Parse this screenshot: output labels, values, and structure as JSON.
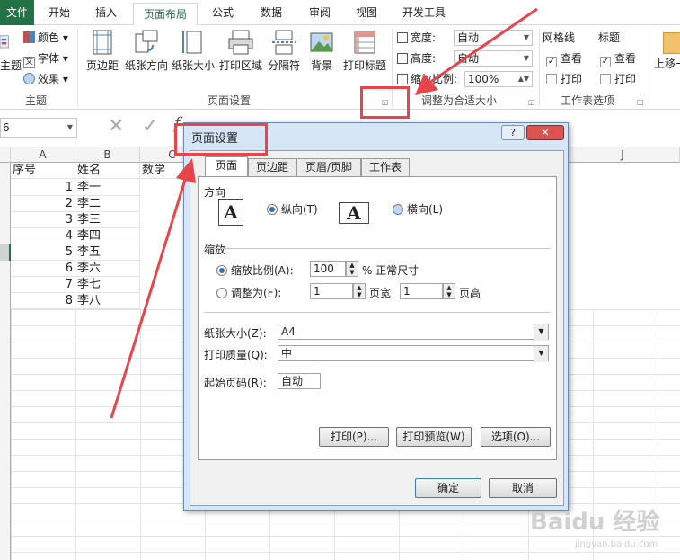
{
  "ribbon_tabs": [
    "文件",
    "开始",
    "插入",
    "页面布局",
    "公式",
    "数据",
    "审阅",
    "视图",
    "开发工具"
  ],
  "theme_group": {
    "colors": "颜色",
    "fonts": "字体",
    "effects": "效果",
    "themes_partial": "主题",
    "label": "主题"
  },
  "page_setup_group": {
    "buttons": [
      "页边距",
      "纸张方向",
      "纸张大小",
      "打印区域",
      "分隔符",
      "背景",
      "打印标题"
    ],
    "label": "页面设置"
  },
  "scale_group": {
    "width_label": "宽度:",
    "width_value": "自动",
    "height_label": "高度:",
    "height_value": "自动",
    "scale_label": "缩放比例:",
    "scale_value": "100%",
    "label": "调整为合适大小"
  },
  "sheet_options": {
    "gridlines_title": "网格线",
    "headings_title": "标题",
    "view": "查看",
    "print": "打印",
    "label": "工作表选项"
  },
  "arrange_partial": "上移一",
  "name_box": "6",
  "sheet": {
    "columns": [
      "A",
      "B",
      "C",
      "J"
    ],
    "headers": [
      "序号",
      "姓名",
      "数学"
    ],
    "rows": [
      {
        "num": "1",
        "name": "李一"
      },
      {
        "num": "2",
        "name": "李二"
      },
      {
        "num": "3",
        "name": "李三"
      },
      {
        "num": "4",
        "name": "李四"
      },
      {
        "num": "5",
        "name": "李五"
      },
      {
        "num": "6",
        "name": "李六"
      },
      {
        "num": "7",
        "name": "李七"
      },
      {
        "num": "8",
        "name": "李八"
      }
    ]
  },
  "dialog": {
    "title": "页面设置",
    "help": "?",
    "close": "✕",
    "tabs": [
      "页面",
      "页边距",
      "页眉/页脚",
      "工作表"
    ],
    "orientation": {
      "label": "方向",
      "portrait": "纵向(T)",
      "landscape": "横向(L)"
    },
    "scaling": {
      "label": "缩放",
      "adjust_to": "缩放比例(A):",
      "adjust_value": "100",
      "adjust_suffix": "% 正常尺寸",
      "fit_to": "调整为(F):",
      "pages_wide": "1",
      "pages_wide_label": "页宽",
      "pages_tall": "1",
      "pages_tall_label": "页高"
    },
    "paper_size_label": "纸张大小(Z):",
    "paper_size_value": "A4",
    "print_quality_label": "打印质量(Q):",
    "print_quality_value": "中",
    "first_page_label": "起始页码(R):",
    "first_page_value": "自动",
    "print_button": "打印(P)...",
    "preview_button": "打印预览(W)",
    "options_button": "选项(O)...",
    "ok_button": "确定",
    "cancel_button": "取消"
  },
  "colors": {
    "accent_green": "#217346",
    "annotation_red": "#e8454a"
  }
}
